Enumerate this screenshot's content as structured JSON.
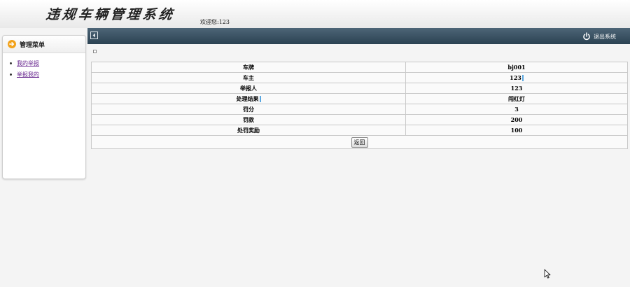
{
  "header": {
    "system_title": "违规车辆管理系统",
    "welcome_text": "欢迎您:123"
  },
  "toolbar": {
    "toggle_icon": "collapse-toggle-icon",
    "logout_label": "退出系统",
    "logout_icon": "power-icon"
  },
  "sidebar": {
    "title": "管理菜单",
    "title_icon": "arrow-right-circle-icon",
    "items": [
      {
        "label": "我的举报"
      },
      {
        "label": "举报我的"
      }
    ]
  },
  "detail": {
    "rows": [
      {
        "label": "车牌",
        "value": "bj001"
      },
      {
        "label": "车主",
        "value": "123"
      },
      {
        "label": "举报人",
        "value": "123"
      },
      {
        "label": "处理结果",
        "value": "闯红灯"
      },
      {
        "label": "罚分",
        "value": "3"
      },
      {
        "label": "罚款",
        "value": "200"
      },
      {
        "label": "处罚奖励",
        "value": "100"
      }
    ],
    "return_label": "返回"
  },
  "colors": {
    "toolbar_top": "#4d6577",
    "toolbar_bottom": "#2b4252",
    "link": "#6a2a90",
    "accent_orange": "#f2a21b"
  }
}
